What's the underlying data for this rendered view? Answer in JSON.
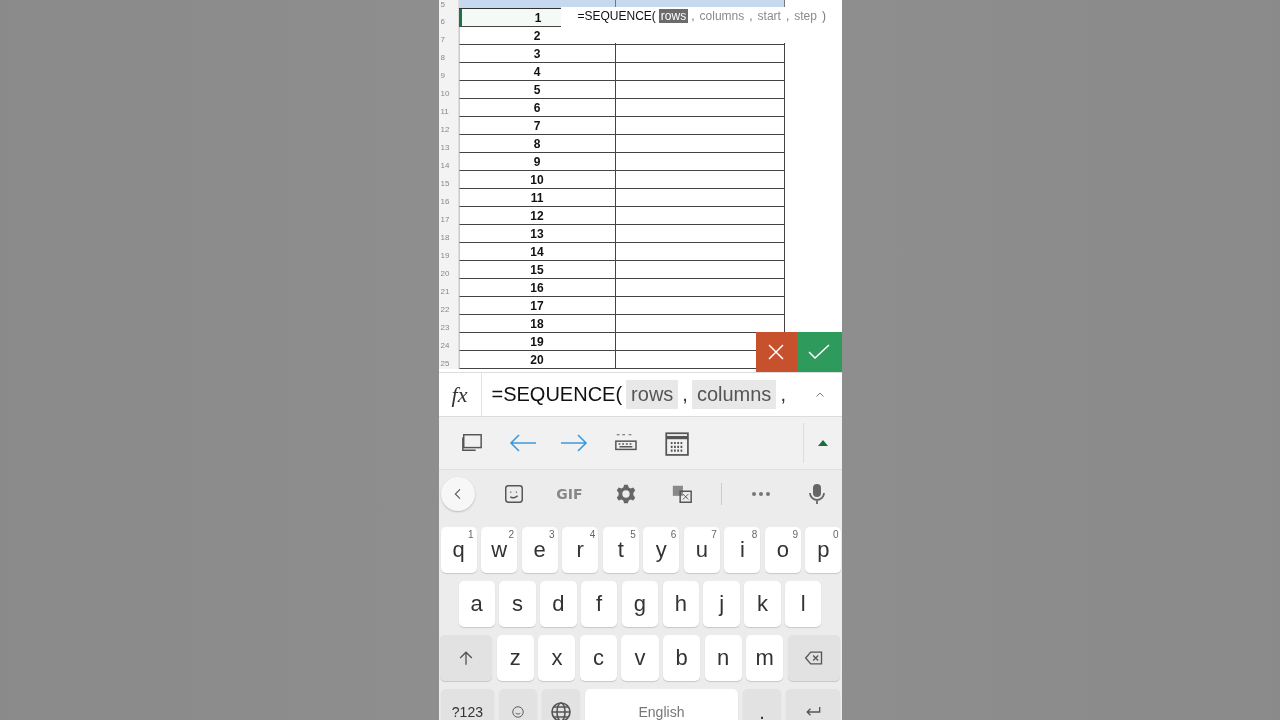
{
  "sheet": {
    "header_row_number": "5",
    "rows": [
      {
        "number": "6",
        "value": "1",
        "active": true
      },
      {
        "number": "7",
        "value": "2",
        "active": false
      },
      {
        "number": "8",
        "value": "3",
        "active": false
      },
      {
        "number": "9",
        "value": "4",
        "active": false
      },
      {
        "number": "10",
        "value": "5",
        "active": false
      },
      {
        "number": "11",
        "value": "6",
        "active": false
      },
      {
        "number": "12",
        "value": "7",
        "active": false
      },
      {
        "number": "13",
        "value": "8",
        "active": false
      },
      {
        "number": "14",
        "value": "9",
        "active": false
      },
      {
        "number": "15",
        "value": "10",
        "active": false
      },
      {
        "number": "16",
        "value": "11",
        "active": false
      },
      {
        "number": "17",
        "value": "12",
        "active": false
      },
      {
        "number": "18",
        "value": "13",
        "active": false
      },
      {
        "number": "19",
        "value": "14",
        "active": false
      },
      {
        "number": "20",
        "value": "15",
        "active": false
      },
      {
        "number": "21",
        "value": "16",
        "active": false
      },
      {
        "number": "22",
        "value": "17",
        "active": false
      },
      {
        "number": "23",
        "value": "18",
        "active": false
      },
      {
        "number": "24",
        "value": "19",
        "active": false
      },
      {
        "number": "25",
        "value": "20",
        "active": false
      }
    ]
  },
  "formula_tooltip": {
    "function": "=SEQUENCE(",
    "args": [
      {
        "text": "rows",
        "selected": true
      },
      {
        "text": "columns",
        "selected": false
      },
      {
        "text": "start",
        "selected": false
      },
      {
        "text": "step",
        "selected": false
      }
    ],
    "separator": ",",
    "close": ")"
  },
  "formula_bar": {
    "label": "fx",
    "function": "=SEQUENCE(",
    "args": [
      "rows",
      "columns"
    ],
    "separator": ","
  },
  "keyboard": {
    "suggestion_bar": {
      "gif": "GIF"
    },
    "rows": [
      {
        "keys": [
          {
            "kind": "letter",
            "label": "q",
            "hint": "1"
          },
          {
            "kind": "letter",
            "label": "w",
            "hint": "2"
          },
          {
            "kind": "letter",
            "label": "e",
            "hint": "3"
          },
          {
            "kind": "letter",
            "label": "r",
            "hint": "4"
          },
          {
            "kind": "letter",
            "label": "t",
            "hint": "5"
          },
          {
            "kind": "letter",
            "label": "y",
            "hint": "6"
          },
          {
            "kind": "letter",
            "label": "u",
            "hint": "7"
          },
          {
            "kind": "letter",
            "label": "i",
            "hint": "8"
          },
          {
            "kind": "letter",
            "label": "o",
            "hint": "9"
          },
          {
            "kind": "letter",
            "label": "p",
            "hint": "0"
          }
        ]
      },
      {
        "keys": [
          {
            "kind": "letter",
            "label": "a"
          },
          {
            "kind": "letter",
            "label": "s"
          },
          {
            "kind": "letter",
            "label": "d"
          },
          {
            "kind": "letter",
            "label": "f"
          },
          {
            "kind": "letter",
            "label": "g"
          },
          {
            "kind": "letter",
            "label": "h"
          },
          {
            "kind": "letter",
            "label": "j"
          },
          {
            "kind": "letter",
            "label": "k"
          },
          {
            "kind": "letter",
            "label": "l"
          }
        ]
      },
      {
        "keys": [
          {
            "kind": "shift"
          },
          {
            "kind": "letter",
            "label": "z"
          },
          {
            "kind": "letter",
            "label": "x"
          },
          {
            "kind": "letter",
            "label": "c"
          },
          {
            "kind": "letter",
            "label": "v"
          },
          {
            "kind": "letter",
            "label": "b"
          },
          {
            "kind": "letter",
            "label": "n"
          },
          {
            "kind": "letter",
            "label": "m"
          },
          {
            "kind": "backspace"
          }
        ]
      },
      {
        "keys": [
          {
            "kind": "symbols",
            "label": "?123"
          },
          {
            "kind": "emoji"
          },
          {
            "kind": "globe"
          },
          {
            "kind": "space",
            "label": "English"
          },
          {
            "kind": "period",
            "label": "."
          },
          {
            "kind": "enter"
          }
        ]
      }
    ]
  }
}
